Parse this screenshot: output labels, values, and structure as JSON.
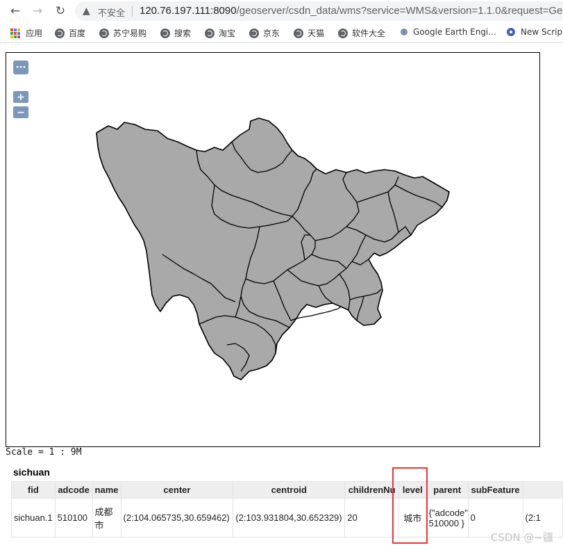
{
  "browser": {
    "security_label": "不安全",
    "url_host": "120.76.197.111:8090",
    "url_path": "/geoserver/csdn_data/wms?service=WMS&version=1.1.0&request=Ge",
    "bookmarks": [
      {
        "label": "应用",
        "icon": "apps-grid-icon"
      },
      {
        "label": "百度",
        "icon": "globe-icon"
      },
      {
        "label": "苏宁易购",
        "icon": "globe-icon"
      },
      {
        "label": "搜索",
        "icon": "globe-icon"
      },
      {
        "label": "淘宝",
        "icon": "globe-icon"
      },
      {
        "label": "京东",
        "icon": "globe-icon"
      },
      {
        "label": "天猫",
        "icon": "globe-icon"
      },
      {
        "label": "软件大全",
        "icon": "globe-icon"
      },
      {
        "label": "Google Earth Engi...",
        "icon": "earth-engine-icon"
      },
      {
        "label": "New Script",
        "icon": "script-icon"
      }
    ]
  },
  "map": {
    "layer_switcher": "···",
    "zoom_in": "+",
    "zoom_out": "−",
    "fill_color": "#a9a9a9",
    "stroke_color": "#000000"
  },
  "scale": {
    "text": "Scale = 1 : 9M"
  },
  "feature_info": {
    "layer_name": "sichuan",
    "columns": [
      "fid",
      "adcode",
      "name",
      "center",
      "centroid",
      "childrenNu",
      "level",
      "parent",
      "subFeature",
      ""
    ],
    "rows": [
      [
        "sichuan.1",
        "510100",
        "成都市",
        "(2:104.065735,30.659462)",
        "(2:103.931804,30.652329)",
        "20",
        "城市",
        "{\"adcode\": 510000 }",
        "0",
        "(2:1"
      ]
    ]
  },
  "watermark": "CSDN @~疆"
}
